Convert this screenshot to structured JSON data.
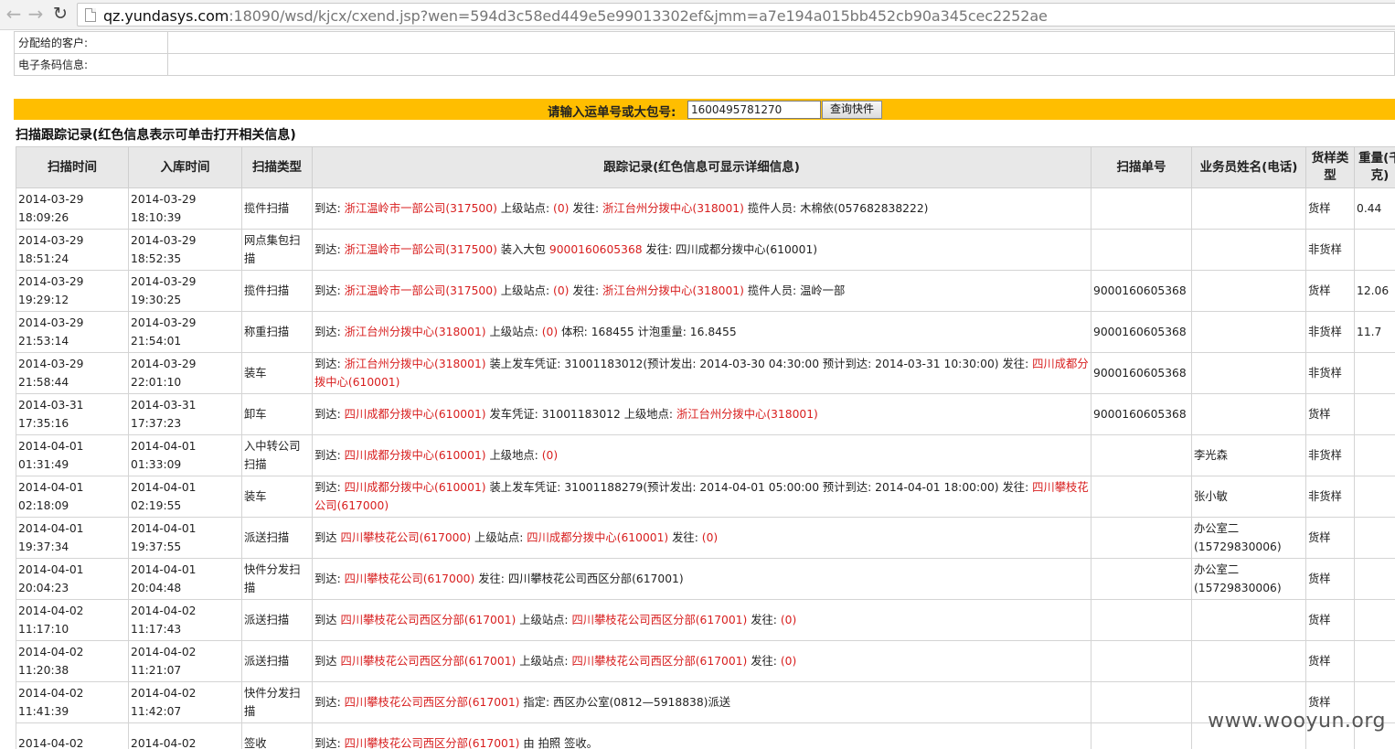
{
  "browser": {
    "url_host": "qz.yundasys.com",
    "url_rest": ":18090/wsd/kjcx/cxend.jsp?wen=594d3c58ed449e5e99013302ef&jmm=a7e194a015bb452cb90a345cec2252ae"
  },
  "info": {
    "customer_label": "分配给的客户:",
    "barcode_label": "电子条码信息:"
  },
  "search": {
    "label": "请输入运单号或大包号:",
    "value": "1600495781270",
    "button": "查询快件"
  },
  "section_title": "扫描跟踪记录(红色信息表示可单击打开相关信息)",
  "table": {
    "headers": [
      "扫描时间",
      "入库时间",
      "扫描类型",
      "跟踪记录(红色信息可显示详细信息)",
      "扫描单号",
      "业务员姓名(电话)",
      "货样类型",
      "重量(千克)"
    ],
    "rows": [
      {
        "scan_date": "2014-03-29",
        "scan_time": "18:09:26",
        "in_date": "2014-03-29",
        "in_time": "18:10:39",
        "type": "揽件扫描",
        "desc": [
          [
            "n",
            "到达: "
          ],
          [
            "r",
            "浙江温岭市一部公司(317500)"
          ],
          [
            "n",
            " 上级站点: "
          ],
          [
            "r",
            "(0)"
          ],
          [
            "n",
            " 发往: "
          ],
          [
            "r",
            "浙江台州分拨中心(318001)"
          ],
          [
            "n",
            " 揽件人员: 木棉依(057682838222)"
          ]
        ],
        "scan_no": "",
        "staff": "",
        "goods": "货样",
        "weight": "0.44"
      },
      {
        "scan_date": "2014-03-29",
        "scan_time": "18:51:24",
        "in_date": "2014-03-29",
        "in_time": "18:52:35",
        "type": "网点集包扫描",
        "desc": [
          [
            "n",
            "到达: "
          ],
          [
            "r",
            "浙江温岭市一部公司(317500)"
          ],
          [
            "n",
            " 装入大包 "
          ],
          [
            "r",
            "9000160605368"
          ],
          [
            "n",
            " 发往: 四川成都分拨中心(610001)"
          ]
        ],
        "scan_no": "",
        "staff": "",
        "goods": "非货样",
        "weight": ""
      },
      {
        "scan_date": "2014-03-29",
        "scan_time": "19:29:12",
        "in_date": "2014-03-29",
        "in_time": "19:30:25",
        "type": "揽件扫描",
        "desc": [
          [
            "n",
            "到达: "
          ],
          [
            "r",
            "浙江温岭市一部公司(317500)"
          ],
          [
            "n",
            " 上级站点: "
          ],
          [
            "r",
            "(0)"
          ],
          [
            "n",
            " 发往: "
          ],
          [
            "r",
            "浙江台州分拨中心(318001)"
          ],
          [
            "n",
            " 揽件人员: 温岭一部"
          ]
        ],
        "scan_no": "9000160605368",
        "staff": "",
        "goods": "货样",
        "weight": "12.06"
      },
      {
        "scan_date": "2014-03-29",
        "scan_time": "21:53:14",
        "in_date": "2014-03-29",
        "in_time": "21:54:01",
        "type": "称重扫描",
        "desc": [
          [
            "n",
            "到达: "
          ],
          [
            "r",
            "浙江台州分拨中心(318001)"
          ],
          [
            "n",
            " 上级站点: "
          ],
          [
            "r",
            "(0)"
          ],
          [
            "n",
            " 体积: 168455 计泡重量: 16.8455"
          ]
        ],
        "scan_no": "9000160605368",
        "staff": "",
        "goods": "非货样",
        "weight": "11.7"
      },
      {
        "scan_date": "2014-03-29",
        "scan_time": "21:58:44",
        "in_date": "2014-03-29",
        "in_time": "22:01:10",
        "type": "装车",
        "desc": [
          [
            "n",
            "到达: "
          ],
          [
            "r",
            "浙江台州分拨中心(318001)"
          ],
          [
            "n",
            " 装上发车凭证: 31001183012(预计发出: 2014-03-30 04:30:00 预计到达: 2014-03-31 10:30:00) 发往: "
          ],
          [
            "r",
            "四川成都分拨中心(610001)"
          ]
        ],
        "scan_no": "9000160605368",
        "staff": "",
        "goods": "非货样",
        "weight": ""
      },
      {
        "scan_date": "2014-03-31",
        "scan_time": "17:35:16",
        "in_date": "2014-03-31",
        "in_time": "17:37:23",
        "type": "卸车",
        "desc": [
          [
            "n",
            "到达: "
          ],
          [
            "r",
            "四川成都分拨中心(610001)"
          ],
          [
            "n",
            " 发车凭证: 31001183012 上级地点: "
          ],
          [
            "r",
            "浙江台州分拨中心(318001)"
          ]
        ],
        "scan_no": "9000160605368",
        "staff": "",
        "goods": "货样",
        "weight": ""
      },
      {
        "scan_date": "2014-04-01",
        "scan_time": "01:31:49",
        "in_date": "2014-04-01",
        "in_time": "01:33:09",
        "type": "入中转公司扫描",
        "desc": [
          [
            "n",
            "到达: "
          ],
          [
            "r",
            "四川成都分拨中心(610001)"
          ],
          [
            "n",
            " 上级地点: "
          ],
          [
            "r",
            "(0)"
          ]
        ],
        "scan_no": "",
        "staff": "李光森",
        "goods": "非货样",
        "weight": ""
      },
      {
        "scan_date": "2014-04-01",
        "scan_time": "02:18:09",
        "in_date": "2014-04-01",
        "in_time": "02:19:55",
        "type": "装车",
        "desc": [
          [
            "n",
            "到达: "
          ],
          [
            "r",
            "四川成都分拨中心(610001)"
          ],
          [
            "n",
            " 装上发车凭证: 31001188279(预计发出: 2014-04-01 05:00:00 预计到达: 2014-04-01 18:00:00) 发往: "
          ],
          [
            "r",
            "四川攀枝花公司(617000)"
          ]
        ],
        "scan_no": "",
        "staff": "张小敏",
        "goods": "非货样",
        "weight": ""
      },
      {
        "scan_date": "2014-04-01",
        "scan_time": "19:37:34",
        "in_date": "2014-04-01",
        "in_time": "19:37:55",
        "type": "派送扫描",
        "desc": [
          [
            "n",
            "到达 "
          ],
          [
            "r",
            "四川攀枝花公司(617000)"
          ],
          [
            "n",
            " 上级站点: "
          ],
          [
            "r",
            "四川成都分拨中心(610001)"
          ],
          [
            "n",
            " 发往: "
          ],
          [
            "r",
            "(0)"
          ]
        ],
        "scan_no": "",
        "staff": "办公室二(15729830006)",
        "goods": "货样",
        "weight": ""
      },
      {
        "scan_date": "2014-04-01",
        "scan_time": "20:04:23",
        "in_date": "2014-04-01",
        "in_time": "20:04:48",
        "type": "快件分发扫描",
        "desc": [
          [
            "n",
            "到达: "
          ],
          [
            "r",
            "四川攀枝花公司(617000)"
          ],
          [
            "n",
            " 发往: 四川攀枝花公司西区分部(617001)"
          ]
        ],
        "scan_no": "",
        "staff": "办公室二(15729830006)",
        "goods": "货样",
        "weight": ""
      },
      {
        "scan_date": "2014-04-02",
        "scan_time": "11:17:10",
        "in_date": "2014-04-02",
        "in_time": "11:17:43",
        "type": "派送扫描",
        "desc": [
          [
            "n",
            "到达 "
          ],
          [
            "r",
            "四川攀枝花公司西区分部(617001)"
          ],
          [
            "n",
            " 上级站点: "
          ],
          [
            "r",
            "四川攀枝花公司西区分部(617001)"
          ],
          [
            "n",
            " 发往: "
          ],
          [
            "r",
            "(0)"
          ]
        ],
        "scan_no": "",
        "staff": "",
        "goods": "货样",
        "weight": ""
      },
      {
        "scan_date": "2014-04-02",
        "scan_time": "11:20:38",
        "in_date": "2014-04-02",
        "in_time": "11:21:07",
        "type": "派送扫描",
        "desc": [
          [
            "n",
            "到达 "
          ],
          [
            "r",
            "四川攀枝花公司西区分部(617001)"
          ],
          [
            "n",
            " 上级站点: "
          ],
          [
            "r",
            "四川攀枝花公司西区分部(617001)"
          ],
          [
            "n",
            " 发往: "
          ],
          [
            "r",
            "(0)"
          ]
        ],
        "scan_no": "",
        "staff": "",
        "goods": "货样",
        "weight": ""
      },
      {
        "scan_date": "2014-04-02",
        "scan_time": "11:41:39",
        "in_date": "2014-04-02",
        "in_time": "11:42:07",
        "type": "快件分发扫描",
        "desc": [
          [
            "n",
            "到达: "
          ],
          [
            "r",
            "四川攀枝花公司西区分部(617001)"
          ],
          [
            "n",
            " 指定: 西区办公室(0812—5918838)派送"
          ]
        ],
        "scan_no": "",
        "staff": "",
        "goods": "货样",
        "weight": ""
      },
      {
        "scan_date": "2014-04-02",
        "scan_time": "",
        "in_date": "2014-04-02",
        "in_time": "",
        "type": "签收",
        "desc": [
          [
            "n",
            "到达: "
          ],
          [
            "r",
            "四川攀枝花公司西区分部(617001)"
          ],
          [
            "n",
            " 由 拍照 签收。"
          ]
        ],
        "scan_no": "",
        "staff": "",
        "goods": "",
        "weight": ""
      }
    ]
  },
  "watermark": "www.wooyun.org"
}
